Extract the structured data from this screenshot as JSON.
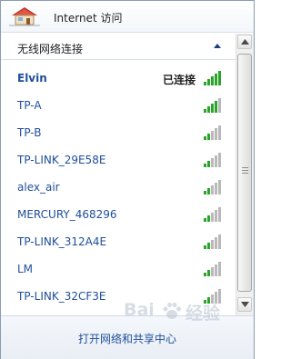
{
  "header": {
    "title": "Internet 访问",
    "icon": "house-icon"
  },
  "section": {
    "label": "无线网络连接",
    "collapse_icon": "chevron-up-icon"
  },
  "networks": [
    {
      "name": "Elvin",
      "status": "已连接",
      "connected": true,
      "signal_bars": 5
    },
    {
      "name": "TP-A",
      "status": "",
      "connected": false,
      "signal_bars": 4
    },
    {
      "name": "TP-B",
      "status": "",
      "connected": false,
      "signal_bars": 2
    },
    {
      "name": "TP-LINK_29E58E",
      "status": "",
      "connected": false,
      "signal_bars": 2
    },
    {
      "name": "alex_air",
      "status": "",
      "connected": false,
      "signal_bars": 2
    },
    {
      "name": "MERCURY_468296",
      "status": "",
      "connected": false,
      "signal_bars": 2
    },
    {
      "name": "TP-LINK_312A4E",
      "status": "",
      "connected": false,
      "signal_bars": 2
    },
    {
      "name": "LM",
      "status": "",
      "connected": false,
      "signal_bars": 2
    },
    {
      "name": "TP-LINK_32CF3E",
      "status": "",
      "connected": false,
      "signal_bars": 2
    }
  ],
  "footer": {
    "link_label": "打开网络和共享中心"
  },
  "watermark": {
    "brand_a": "Bai",
    "brand_b": "经验"
  },
  "colors": {
    "link": "#1f4e9c",
    "signal_active": "#2aa52a",
    "signal_inactive": "#b9b9b9"
  }
}
